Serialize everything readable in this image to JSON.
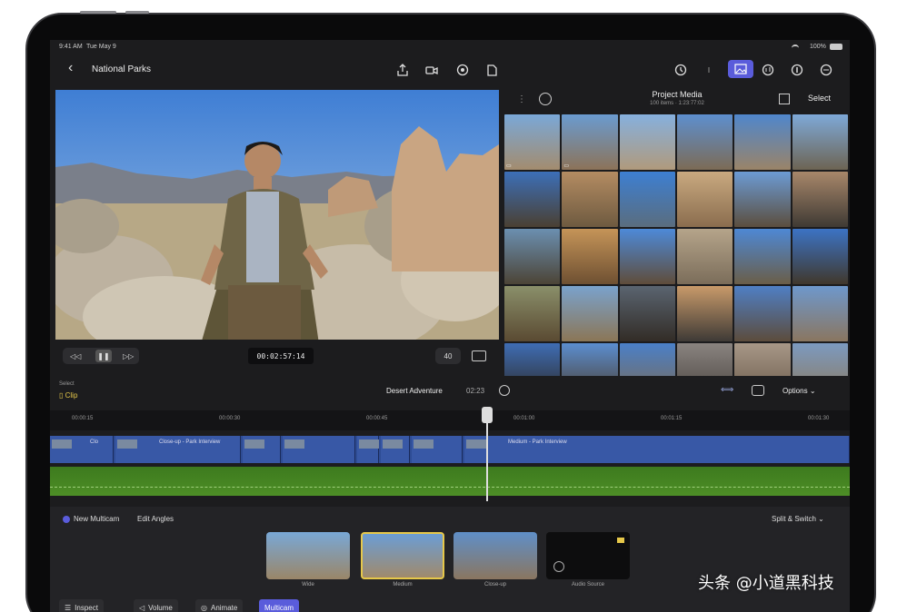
{
  "status_bar": {
    "time": "9:41 AM",
    "date": "Tue May 9",
    "battery": "100%"
  },
  "header": {
    "back_label": "‹",
    "title": "National Parks"
  },
  "viewer": {
    "timecode": "00:02:57:14",
    "zoom": "40"
  },
  "media": {
    "title": "Project Media",
    "subtitle": "100 items · 1:23:77:02",
    "select_label": "Select"
  },
  "timeline": {
    "select_label": "Select",
    "clip_label": "Clip",
    "project_name": "Desert Adventure",
    "duration": "02:23",
    "options_label": "Options",
    "ruler": [
      "00:00:15",
      "00:00:30",
      "00:00:45",
      "00:01:00",
      "00:01:15",
      "00:01:30"
    ],
    "clip_labels": [
      "Clo",
      "Close-up - Park Interview",
      "Medium - Park Interview"
    ]
  },
  "multicam": {
    "new_label": "New Multicam",
    "edit_angles_label": "Edit Angles",
    "split_switch_label": "Split & Switch",
    "angles": [
      "Wide",
      "Medium",
      "Close-up",
      "Audio Source"
    ]
  },
  "bottom_tabs": {
    "inspect": "Inspect",
    "volume": "Volume",
    "animate": "Animate",
    "multicam": "Multicam"
  },
  "watermark": "头条 @小道黑科技",
  "colors": {
    "accent": "#5a5cdb",
    "clip_blue": "#3858a6",
    "audio_green": "#4d8e26",
    "highlight": "#e6c84a"
  }
}
